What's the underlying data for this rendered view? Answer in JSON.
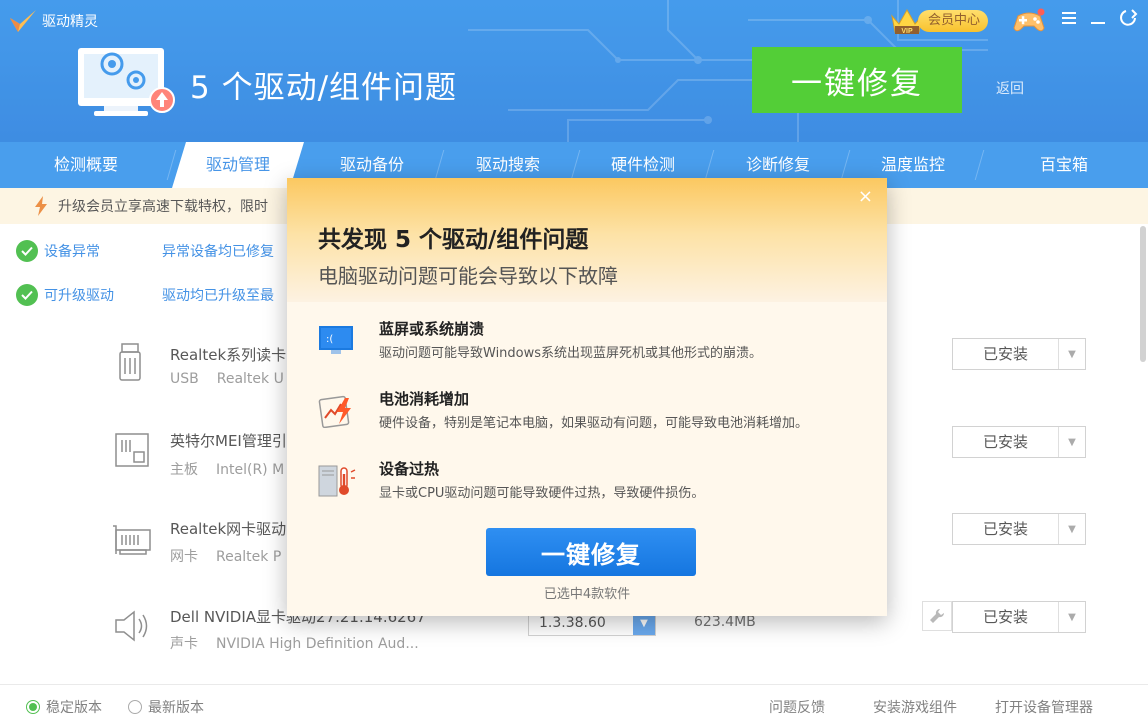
{
  "app": {
    "name": "驱动精灵"
  },
  "header": {
    "issue_title": "5 个驱动/组件问题",
    "fix_button": "一键修复",
    "back": "返回",
    "vip_label": "会员中心"
  },
  "tabs": [
    {
      "label": "检测概要",
      "active": false
    },
    {
      "label": "驱动管理",
      "active": true
    },
    {
      "label": "驱动备份",
      "active": false
    },
    {
      "label": "驱动搜索",
      "active": false
    },
    {
      "label": "硬件检测",
      "active": false
    },
    {
      "label": "诊断修复",
      "active": false
    },
    {
      "label": "温度监控",
      "active": false
    },
    {
      "label": "百宝箱",
      "active": false
    }
  ],
  "banner": {
    "text": "升级会员立享高速下载特权，限时"
  },
  "status": [
    {
      "label": "设备异常",
      "message": "异常设备均已修复"
    },
    {
      "label": "可升级驱动",
      "message": "驱动均已升级至最"
    }
  ],
  "drivers": [
    {
      "name": "Realtek系列读卡",
      "category": "USB",
      "detail": "Realtek U",
      "status": "已安装",
      "icon": "card-reader-icon"
    },
    {
      "name": "英特尔MEI管理引",
      "category": "主板",
      "detail": "Intel(R) M",
      "status": "已安装",
      "icon": "motherboard-icon"
    },
    {
      "name": "Realtek网卡驱动",
      "category": "网卡",
      "detail": "Realtek P",
      "status": "已安装",
      "icon": "network-card-icon"
    },
    {
      "name": "Dell NVIDIA显卡驱动27.21.14.6267",
      "category": "声卡",
      "detail": "NVIDIA High Definition Aud...",
      "status": "已安装",
      "version": "1.3.38.60",
      "size": "623.4MB",
      "icon": "speaker-icon"
    }
  ],
  "footer": {
    "stable": "稳定版本",
    "latest": "最新版本",
    "feedback": "问题反馈",
    "install_game": "安装游戏组件",
    "open_device_mgr": "打开设备管理器"
  },
  "modal": {
    "title": "共发现 5 个驱动/组件问题",
    "subtitle": "电脑驱动问题可能会导致以下故障",
    "close": "×",
    "items": [
      {
        "title": "蓝屏或系统崩溃",
        "desc": "驱动问题可能导致Windows系统出现蓝屏死机或其他形式的崩溃。",
        "icon": "bluescreen-icon"
      },
      {
        "title": "电池消耗增加",
        "desc": "硬件设备，特别是笔记本电脑，如果驱动有问题，可能导致电池消耗增加。",
        "icon": "battery-drain-icon"
      },
      {
        "title": "设备过热",
        "desc": "显卡或CPU驱动问题可能导致硬件过热，导致硬件损伤。",
        "icon": "overheat-icon"
      }
    ],
    "fix_button": "一键修复",
    "selected": "已选中4款软件"
  },
  "colors": {
    "header_blue": "#1d86e8",
    "fix_green": "#2ec40c",
    "modal_blue": "#1f84ee",
    "check_green": "#2db22d"
  }
}
